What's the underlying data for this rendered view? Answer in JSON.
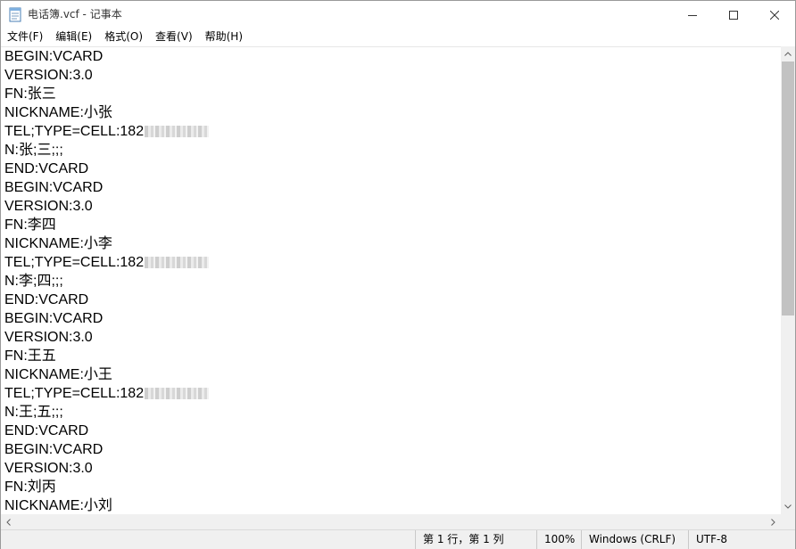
{
  "window": {
    "title": "电话簿.vcf - 记事本",
    "icon": "notepad-icon"
  },
  "menu": [
    "文件(F)",
    "编辑(E)",
    "格式(O)",
    "查看(V)",
    "帮助(H)"
  ],
  "editor": {
    "lines": [
      "BEGIN:VCARD",
      "VERSION:3.0",
      "FN:张三",
      "NICKNAME:小张",
      "TEL;TYPE=CELL:182",
      "N:张;三;;;",
      "END:VCARD",
      "BEGIN:VCARD",
      "VERSION:3.0",
      "FN:李四",
      "NICKNAME:小李",
      "TEL;TYPE=CELL:182",
      "N:李;四;;;",
      "END:VCARD",
      "BEGIN:VCARD",
      "VERSION:3.0",
      "FN:王五",
      "NICKNAME:小王",
      "TEL;TYPE=CELL:182",
      "N:王;五;;;",
      "END:VCARD",
      "BEGIN:VCARD",
      "VERSION:3.0",
      "FN:刘丙",
      "NICKNAME:小刘"
    ],
    "redacted_line_indices": [
      4,
      11,
      18
    ]
  },
  "statusbar": {
    "position": "第 1 行，第 1 列",
    "zoom": "100%",
    "line_ending": "Windows (CRLF)",
    "encoding": "UTF-8"
  }
}
